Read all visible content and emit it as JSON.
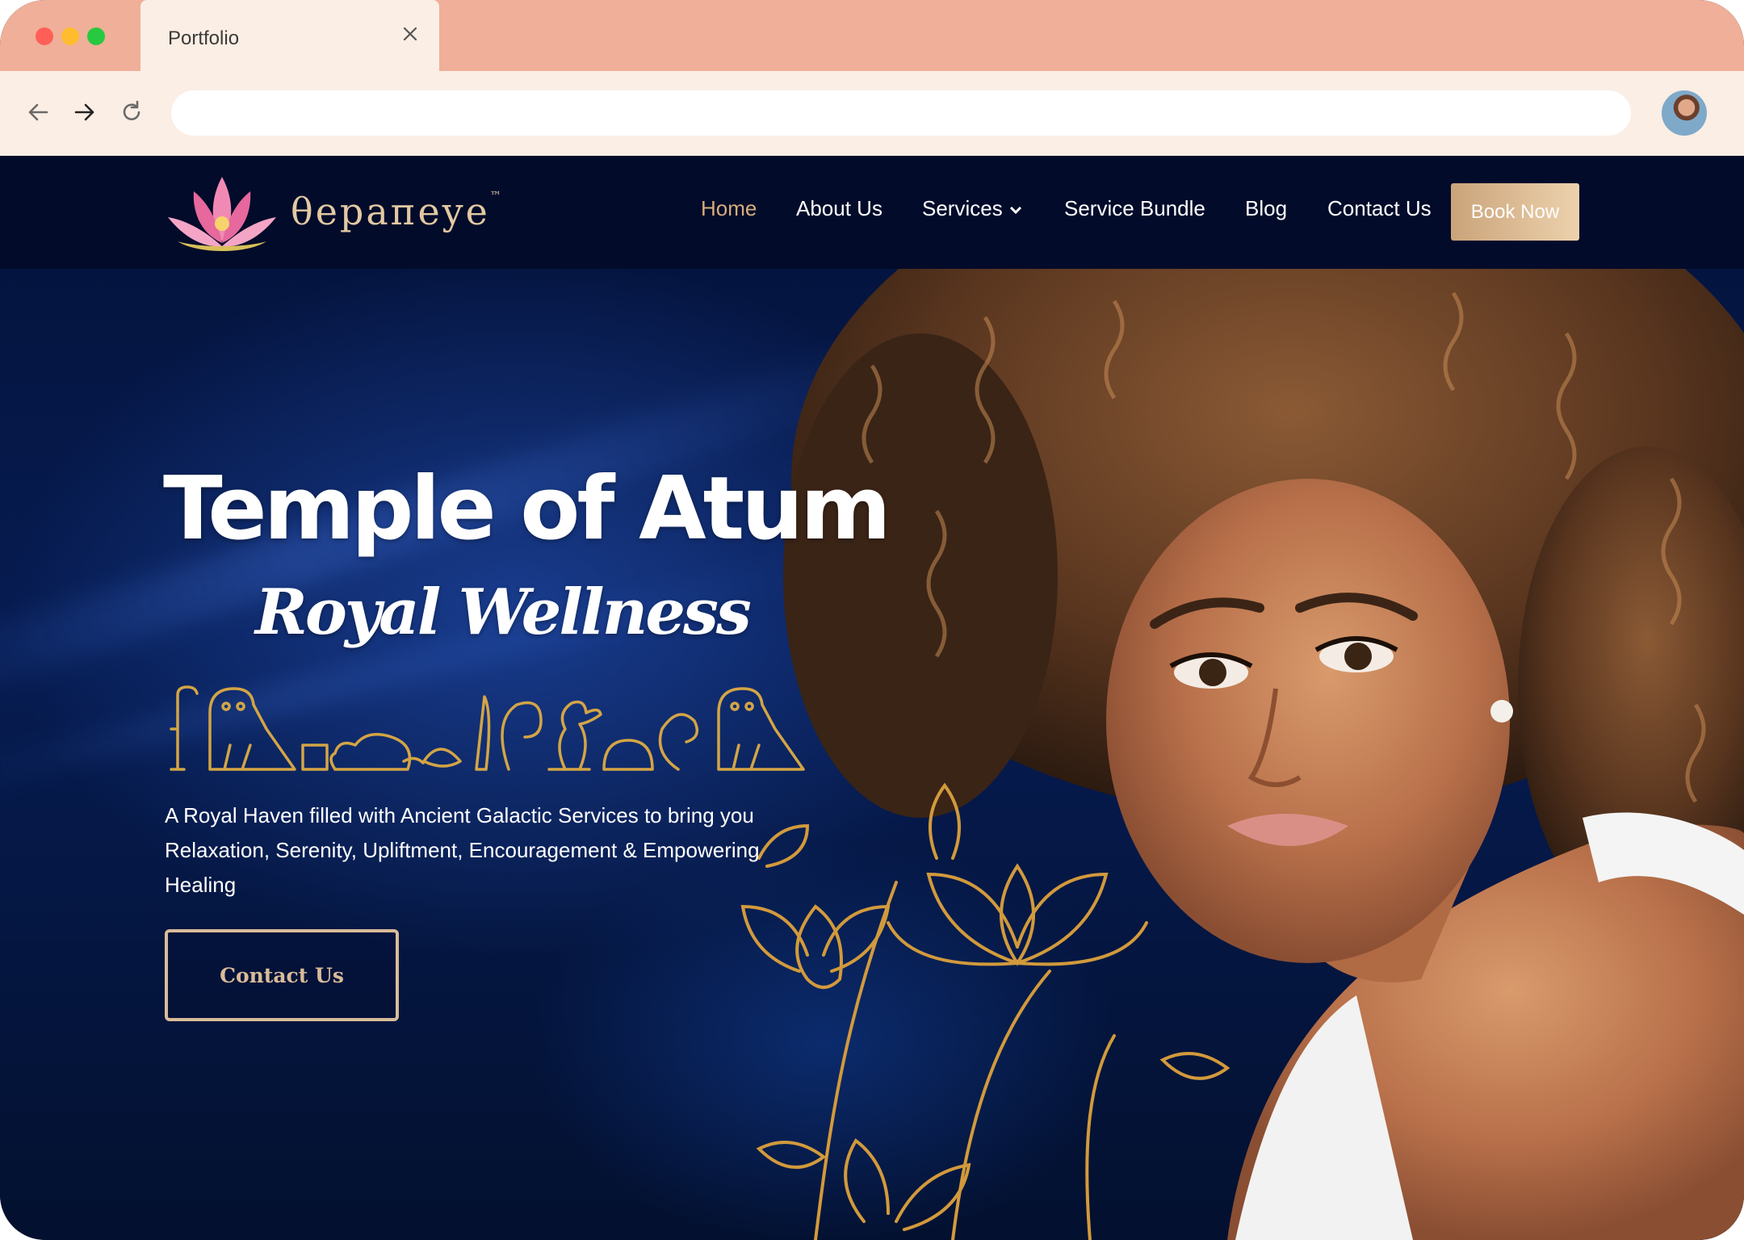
{
  "browser": {
    "tab_title": "Portfolio",
    "url": "",
    "traffic_lights": [
      "#ff5f57",
      "#febc2e",
      "#28c840"
    ]
  },
  "site": {
    "logo_text": "θеpaпeye",
    "logo_tm": "™",
    "nav": [
      {
        "label": "Home",
        "active": true
      },
      {
        "label": "About Us"
      },
      {
        "label": "Services",
        "has_dropdown": true
      },
      {
        "label": "Service Bundle"
      },
      {
        "label": "Blog"
      },
      {
        "label": "Contact Us"
      }
    ],
    "book_button": "Book Now",
    "hero": {
      "title": "Temple of Atum",
      "subtitle": "Royal Wellness",
      "description": "A Royal Haven filled with Ancient Galactic Services to bring you Relaxation, Serenity, Upliftment, Encouragement & Empowering Healing",
      "cta": "Contact Us"
    },
    "colors": {
      "navy": "#020b2a",
      "gold": "#d6ad7c",
      "chrome": "#efaf98",
      "chrome_light": "#fbeee4"
    }
  }
}
